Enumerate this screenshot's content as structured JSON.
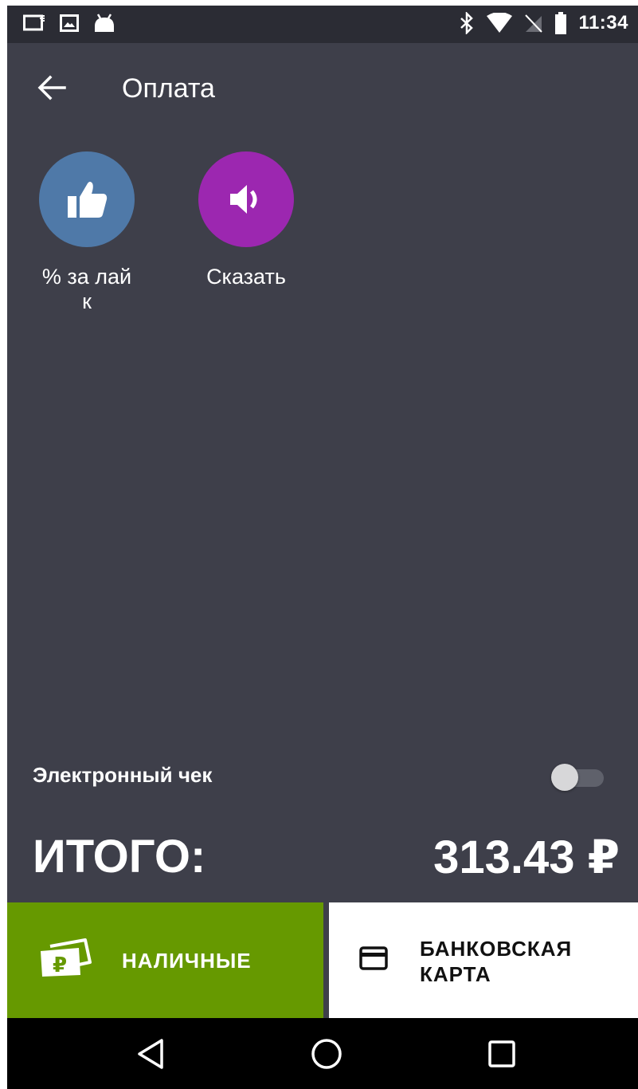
{
  "status_bar": {
    "time": "11:34",
    "left_icons": [
      "cast-icon",
      "image-icon",
      "android-icon"
    ],
    "right_icons": [
      "bluetooth-icon",
      "wifi-icon",
      "no-sim-icon",
      "battery-icon"
    ]
  },
  "app_bar": {
    "title": "Оплата"
  },
  "quick_actions": [
    {
      "label": "% за лайк",
      "icon": "thumbs-up-icon",
      "color": "#4f79a8"
    },
    {
      "label": "Сказать",
      "icon": "speaker-icon",
      "color": "#9c27b0"
    }
  ],
  "receipt": {
    "label": "Электронный чек",
    "enabled": false
  },
  "total": {
    "label": "ИТОГО:",
    "value": "313.43 ₽"
  },
  "payment": {
    "cash_label": "НАЛИЧНЫЕ",
    "card_label": "БАНКОВСКАЯ КАРТА"
  },
  "colors": {
    "background": "#3e3f4a",
    "cash_green": "#669900",
    "card_white": "#ffffff"
  },
  "nav_bar": {
    "buttons": [
      "back-triangle-icon",
      "home-circle-icon",
      "recents-square-icon"
    ]
  }
}
